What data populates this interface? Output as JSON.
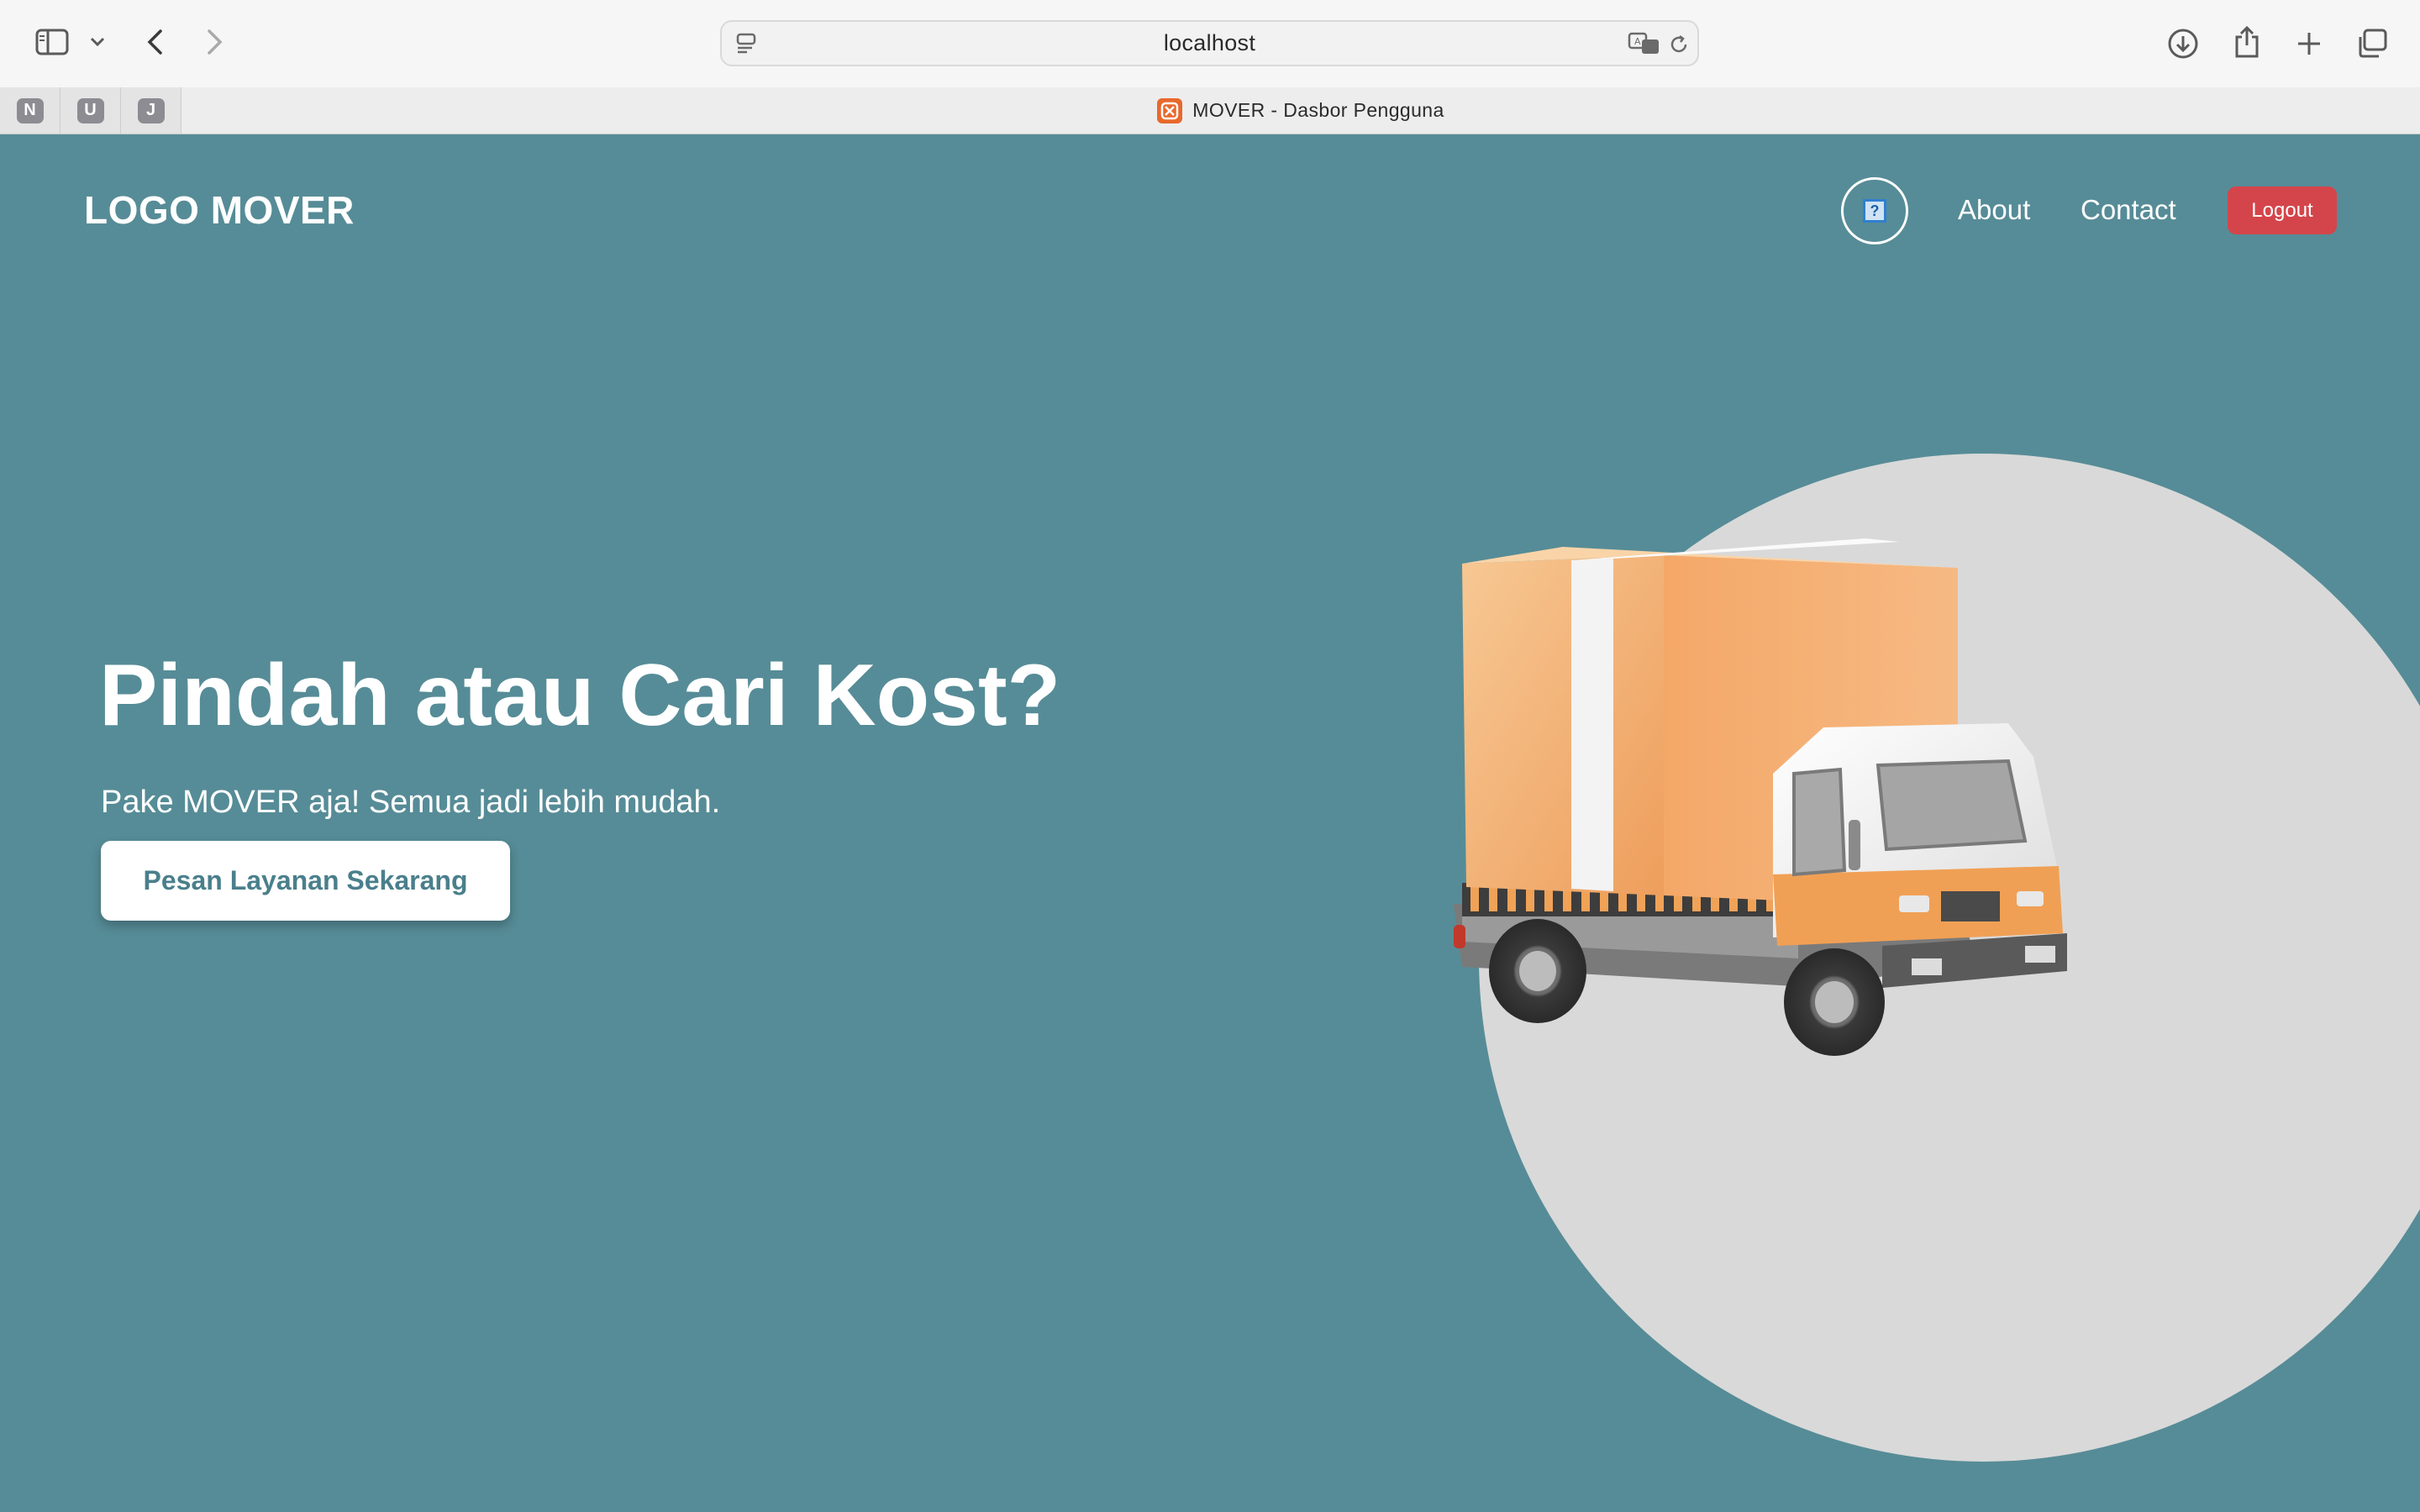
{
  "browser": {
    "url": "localhost",
    "tab_title": "MOVER - Dasbor Pengguna",
    "pinned_tabs": [
      "N",
      "U",
      "J"
    ]
  },
  "nav": {
    "logo": "LOGO MOVER",
    "links": [
      "About",
      "Contact"
    ],
    "logout_label": "Logout",
    "help_icon_glyph": "?"
  },
  "hero": {
    "title": "Pindah atau Cari Kost?",
    "subtitle": "Pake MOVER aja! Semua jadi lebih mudah.",
    "cta_label": "Pesan Layanan Sekarang"
  },
  "colors": {
    "page_background": "#568c97",
    "circle": "#d9d9d9",
    "logout": "#d4454b",
    "cta_text": "#4a7f8c"
  }
}
